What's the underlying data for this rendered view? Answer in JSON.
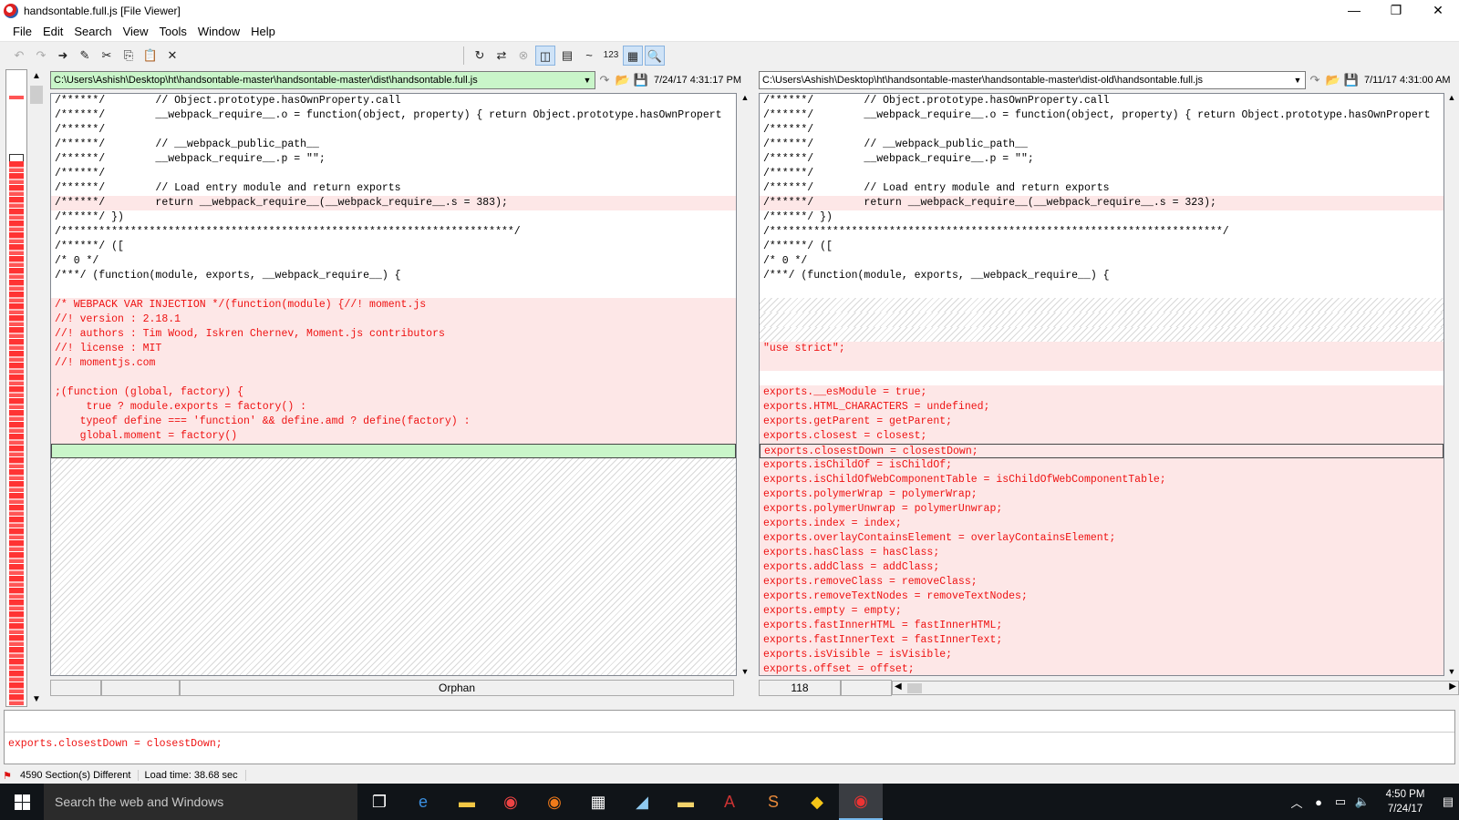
{
  "window": {
    "title": "handsontable.full.js  [File Viewer]",
    "minimize": "—",
    "maximize": "❐",
    "close": "✕"
  },
  "menu": [
    {
      "label": "File"
    },
    {
      "label": "Edit"
    },
    {
      "label": "Search"
    },
    {
      "label": "View"
    },
    {
      "label": "Tools"
    },
    {
      "label": "Window"
    },
    {
      "label": "Help"
    }
  ],
  "toolbar": {
    "undo": "↶",
    "redo": "↷",
    "next": "➜",
    "edit": "✎",
    "cut": "✂",
    "copy": "⎘",
    "paste": "📋",
    "delete": "✕",
    "sync": "↻",
    "rescan": "⇄",
    "stop": "⊗",
    "side_by_side": "◫",
    "over_under": "▤",
    "ignore_unimportant": "~",
    "line_numbers": "123",
    "context": "▦",
    "find": "🔍"
  },
  "left": {
    "path": "C:\\Users\\Ashish\\Desktop\\ht\\handsontable-master\\handsontable-master\\dist\\handsontable.full.js",
    "date": "7/24/17 4:31:17 PM",
    "status_orphan": "Orphan",
    "lines": [
      {
        "t": "/******/        // Object.prototype.hasOwnProperty.call",
        "k": "n"
      },
      {
        "t": "/******/        __webpack_require__.o = function(object, property) { return Object.prototype.hasOwnPropert",
        "k": "n"
      },
      {
        "t": "/******/",
        "k": "n"
      },
      {
        "t": "/******/        // __webpack_public_path__",
        "k": "n"
      },
      {
        "t": "/******/        __webpack_require__.p = \"\";",
        "k": "n"
      },
      {
        "t": "/******/",
        "k": "n"
      },
      {
        "t": "/******/        // Load entry module and return exports",
        "k": "n"
      },
      {
        "t": "/******/        return __webpack_require__(__webpack_require__.s = 383);",
        "k": "db"
      },
      {
        "t": "/******/ })",
        "k": "n"
      },
      {
        "t": "/************************************************************************/",
        "k": "n"
      },
      {
        "t": "/******/ ([",
        "k": "n"
      },
      {
        "t": "/* 0 */",
        "k": "n"
      },
      {
        "t": "/***/ (function(module, exports, __webpack_require__) {",
        "k": "n"
      },
      {
        "t": "",
        "k": "n"
      },
      {
        "t": "/* WEBPACK VAR INJECTION */(function(module) {//! moment.js",
        "k": "d"
      },
      {
        "t": "//! version : 2.18.1",
        "k": "d"
      },
      {
        "t": "//! authors : Tim Wood, Iskren Chernev, Moment.js contributors",
        "k": "d"
      },
      {
        "t": "//! license : MIT",
        "k": "d"
      },
      {
        "t": "//! momentjs.com",
        "k": "d"
      },
      {
        "t": "",
        "k": "b"
      },
      {
        "t": ";(function (global, factory) {",
        "k": "d"
      },
      {
        "t": "     true ? module.exports = factory() :",
        "k": "d"
      },
      {
        "t": "    typeof define === 'function' && define.amd ? define(factory) :",
        "k": "d"
      },
      {
        "t": "    global.moment = factory()",
        "k": "d"
      },
      {
        "t": "",
        "k": "a"
      }
    ]
  },
  "right": {
    "path": "C:\\Users\\Ashish\\Desktop\\ht\\handsontable-master\\handsontable-master\\dist-old\\handsontable.full.js",
    "date": "7/11/17 4:31:00 AM",
    "status_line": "118",
    "lines": [
      {
        "t": "/******/        // Object.prototype.hasOwnProperty.call",
        "k": "n"
      },
      {
        "t": "/******/        __webpack_require__.o = function(object, property) { return Object.prototype.hasOwnPropert",
        "k": "n"
      },
      {
        "t": "/******/",
        "k": "n"
      },
      {
        "t": "/******/        // __webpack_public_path__",
        "k": "n"
      },
      {
        "t": "/******/        __webpack_require__.p = \"\";",
        "k": "n"
      },
      {
        "t": "/******/",
        "k": "n"
      },
      {
        "t": "/******/        // Load entry module and return exports",
        "k": "n"
      },
      {
        "t": "/******/        return __webpack_require__(__webpack_require__.s = 323);",
        "k": "db"
      },
      {
        "t": "/******/ })",
        "k": "n"
      },
      {
        "t": "/************************************************************************/",
        "k": "n"
      },
      {
        "t": "/******/ ([",
        "k": "n"
      },
      {
        "t": "/* 0 */",
        "k": "n"
      },
      {
        "t": "/***/ (function(module, exports, __webpack_require__) {",
        "k": "n"
      },
      {
        "t": "",
        "k": "n"
      },
      {
        "t": "",
        "k": "h"
      },
      {
        "t": "",
        "k": "h"
      },
      {
        "t": "",
        "k": "h"
      },
      {
        "t": "\"use strict\";",
        "k": "d"
      },
      {
        "t": "",
        "k": "b"
      },
      {
        "t": "",
        "k": "n"
      },
      {
        "t": "exports.__esModule = true;",
        "k": "d"
      },
      {
        "t": "exports.HTML_CHARACTERS = undefined;",
        "k": "d"
      },
      {
        "t": "exports.getParent = getParent;",
        "k": "d"
      },
      {
        "t": "exports.closest = closest;",
        "k": "d"
      },
      {
        "t": "exports.closestDown = closestDown;",
        "k": "s"
      },
      {
        "t": "exports.isChildOf = isChildOf;",
        "k": "d"
      },
      {
        "t": "exports.isChildOfWebComponentTable = isChildOfWebComponentTable;",
        "k": "d"
      },
      {
        "t": "exports.polymerWrap = polymerWrap;",
        "k": "d"
      },
      {
        "t": "exports.polymerUnwrap = polymerUnwrap;",
        "k": "d"
      },
      {
        "t": "exports.index = index;",
        "k": "d"
      },
      {
        "t": "exports.overlayContainsElement = overlayContainsElement;",
        "k": "d"
      },
      {
        "t": "exports.hasClass = hasClass;",
        "k": "d"
      },
      {
        "t": "exports.addClass = addClass;",
        "k": "d"
      },
      {
        "t": "exports.removeClass = removeClass;",
        "k": "d"
      },
      {
        "t": "exports.removeTextNodes = removeTextNodes;",
        "k": "d"
      },
      {
        "t": "exports.empty = empty;",
        "k": "d"
      },
      {
        "t": "exports.fastInnerHTML = fastInnerHTML;",
        "k": "d"
      },
      {
        "t": "exports.fastInnerText = fastInnerText;",
        "k": "d"
      },
      {
        "t": "exports.isVisible = isVisible;",
        "k": "d"
      },
      {
        "t": "exports.offset = offset;",
        "k": "d"
      }
    ]
  },
  "detail": {
    "text": "exports.closestDown = closestDown;"
  },
  "statusbar": {
    "sections": "4590 Section(s) Different",
    "load_time": "Load time:  38.68 sec"
  },
  "taskbar": {
    "search_placeholder": "Search the web and Windows",
    "time": "4:50 PM",
    "date": "7/24/17"
  },
  "colors": {
    "diff_bg": "#fde7e7",
    "diff_text": "#ee1111",
    "added_bg": "#c9f5c9"
  }
}
